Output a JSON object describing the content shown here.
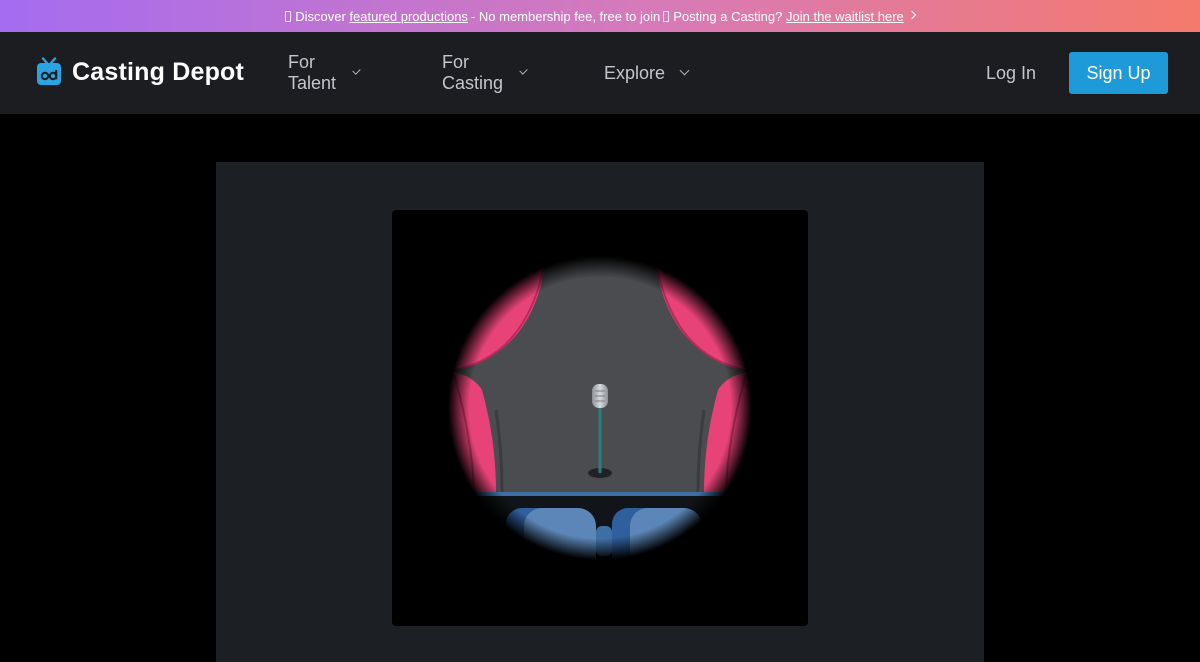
{
  "banner": {
    "lead_icon": "play-icon",
    "discover_text": "Discover",
    "featured_link": "featured productions",
    "middle_text": "- No membership fee, free to join",
    "posting_text": "Posting a Casting?",
    "waitlist_link": "Join the waitlist here",
    "trail_icon": "chevron-right-icon",
    "gradient_start": "#a46cf0",
    "gradient_end": "#f57a6c"
  },
  "header": {
    "brand": "Casting Depot",
    "logo_icon": "tv-icon",
    "nav": [
      {
        "label": "For Talent",
        "icon": "chevron-down-icon"
      },
      {
        "label": "For Casting",
        "icon": "chevron-down-icon"
      },
      {
        "label": "Explore",
        "icon": "chevron-down-icon"
      }
    ],
    "login_label": "Log In",
    "signup_label": "Sign Up",
    "accent_color": "#1f9ad8"
  },
  "hero": {
    "image_name": "stage-spotlight-illustration",
    "curtain_color": "#e84378",
    "stage_color": "#4a4c50",
    "seat_color": "#5b86b7"
  }
}
